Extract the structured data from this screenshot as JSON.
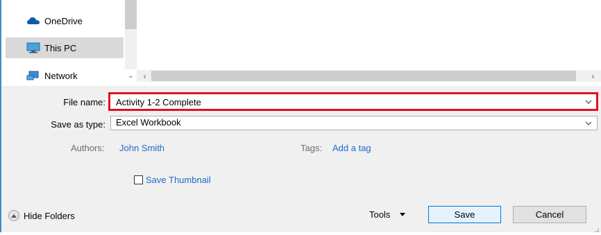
{
  "navigation": {
    "items": [
      {
        "label": "OneDrive",
        "icon": "onedrive-cloud-icon",
        "selected": false
      },
      {
        "label": "This PC",
        "icon": "computer-icon",
        "selected": true
      },
      {
        "label": "Network",
        "icon": "network-icon",
        "selected": false
      }
    ]
  },
  "form": {
    "file_name_label": "File name:",
    "file_name_value": "Activity 1-2 Complete",
    "save_as_type_label": "Save as type:",
    "save_as_type_value": "Excel Workbook",
    "authors_label": "Authors:",
    "authors_value": "John Smith",
    "tags_label": "Tags:",
    "tags_value": "Add a tag",
    "thumbnail_label": "Save Thumbnail",
    "thumbnail_checked": false
  },
  "footer": {
    "hide_folders_label": "Hide Folders",
    "tools_label": "Tools",
    "save_label": "Save",
    "cancel_label": "Cancel"
  },
  "colors": {
    "highlight_border": "#e0111c",
    "link": "#1e6ac7",
    "primary_button_border": "#0078d7"
  }
}
